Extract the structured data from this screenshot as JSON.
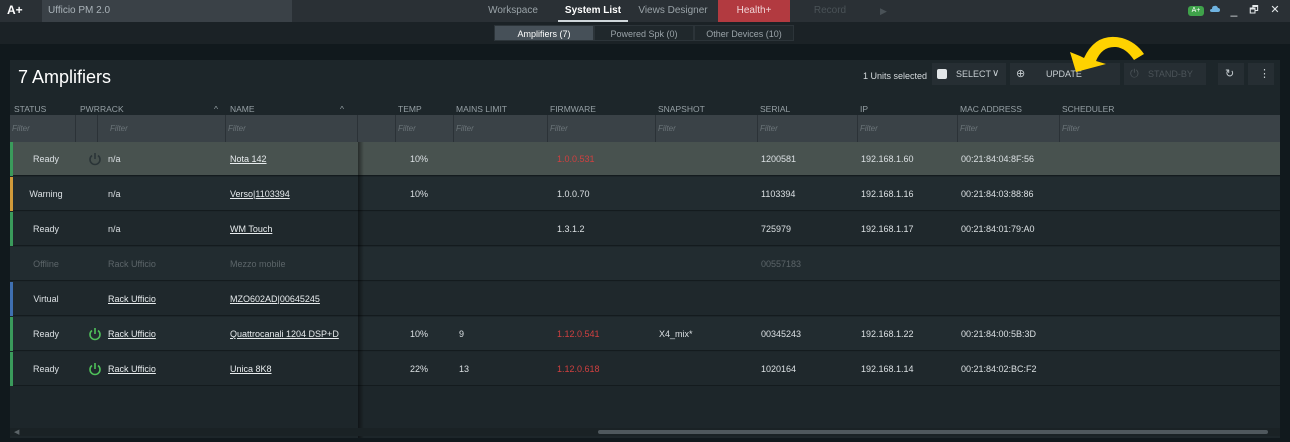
{
  "titlebar": {
    "logo": "A+",
    "app_title": "Ufficio PM 2.0",
    "tabs": [
      {
        "label": "Workspace",
        "state": "normal"
      },
      {
        "label": "System List",
        "state": "active"
      },
      {
        "label": "Views Designer",
        "state": "normal"
      },
      {
        "label": "Health+",
        "state": "health"
      },
      {
        "label": "Record",
        "state": "dim"
      }
    ],
    "badge": "A+",
    "minimize": "_",
    "restore": "🗗",
    "close": "✕"
  },
  "subtabs": [
    {
      "label": "Amplifiers (7)",
      "active": true
    },
    {
      "label": "Powered Spk (0)",
      "active": false
    },
    {
      "label": "Other Devices (10)",
      "active": false
    }
  ],
  "panel": {
    "title": "7 Amplifiers",
    "selection": "1 Units selected",
    "select_label": "SELECT",
    "update_label": "UPDATE",
    "standby_label": "STAND-BY",
    "refresh_icon": "refresh-icon",
    "more_icon": "more-vertical-icon"
  },
  "columns": {
    "status": "STATUS",
    "pwr": "PWR",
    "rack": "RACK",
    "name": "NAME",
    "temp": "TEMP",
    "mains": "MAINS LIMIT",
    "firmware": "FIRMWARE",
    "snapshot": "SNAPSHOT",
    "serial": "SERIAL",
    "ip": "IP",
    "mac": "MAC ADDRESS",
    "scheduler": "SCHEDULER"
  },
  "filter_placeholder": "Filter",
  "rows": [
    {
      "status": "Ready",
      "pwr": "",
      "rack": "n/a",
      "name": "Nota 142",
      "temp": "10%",
      "mains": "",
      "firmware": "1.0.0.531",
      "snapshot": "",
      "serial": "1200581",
      "ip": "192.168.1.60",
      "mac": "00:21:84:04:8F:56"
    },
    {
      "status": "Warning",
      "pwr": "",
      "rack": "n/a",
      "name": "Verso|1103394",
      "temp": "10%",
      "mains": "",
      "firmware": "1.0.0.70",
      "snapshot": "",
      "serial": "1103394",
      "ip": "192.168.1.16",
      "mac": "00:21:84:03:88:86"
    },
    {
      "status": "Ready",
      "pwr": "",
      "rack": "n/a",
      "name": "WM Touch",
      "temp": "",
      "mains": "",
      "firmware": "1.3.1.2",
      "snapshot": "",
      "serial": "725979",
      "ip": "192.168.1.17",
      "mac": "00:21:84:01:79:A0"
    },
    {
      "status": "Offline",
      "pwr": "",
      "rack": "Rack Ufficio",
      "name": "Mezzo mobile",
      "temp": "",
      "mains": "",
      "firmware": "",
      "snapshot": "",
      "serial": "00557183",
      "ip": "",
      "mac": ""
    },
    {
      "status": "Virtual",
      "pwr": "",
      "rack": "Rack Ufficio",
      "name": "MZO602AD|00645245",
      "temp": "",
      "mains": "",
      "firmware": "",
      "snapshot": "",
      "serial": "",
      "ip": "",
      "mac": ""
    },
    {
      "status": "Ready",
      "pwr": "on",
      "rack": "Rack Ufficio",
      "name": "Quattrocanali 1204 DSP+D",
      "temp": "10%",
      "mains": "9",
      "firmware": "1.12.0.541",
      "snapshot": "X4_mix*",
      "serial": "00345243",
      "ip": "192.168.1.22",
      "mac": "00:21:84:00:5B:3D"
    },
    {
      "status": "Ready",
      "pwr": "on",
      "rack": "Rack Ufficio",
      "name": "Unica 8K8",
      "temp": "22%",
      "mains": "13",
      "firmware": "1.12.0.618",
      "snapshot": "",
      "serial": "1020164",
      "ip": "192.168.1.14",
      "mac": "00:21:84:02:BC:F2"
    }
  ],
  "colors": {
    "ready": "#3a9a5b",
    "warning": "#d09a3a",
    "virtual": "#3f6fb0",
    "power_on": "#4fc15a",
    "firmware_alert": "#d04040",
    "annotation": "#ffd200"
  }
}
